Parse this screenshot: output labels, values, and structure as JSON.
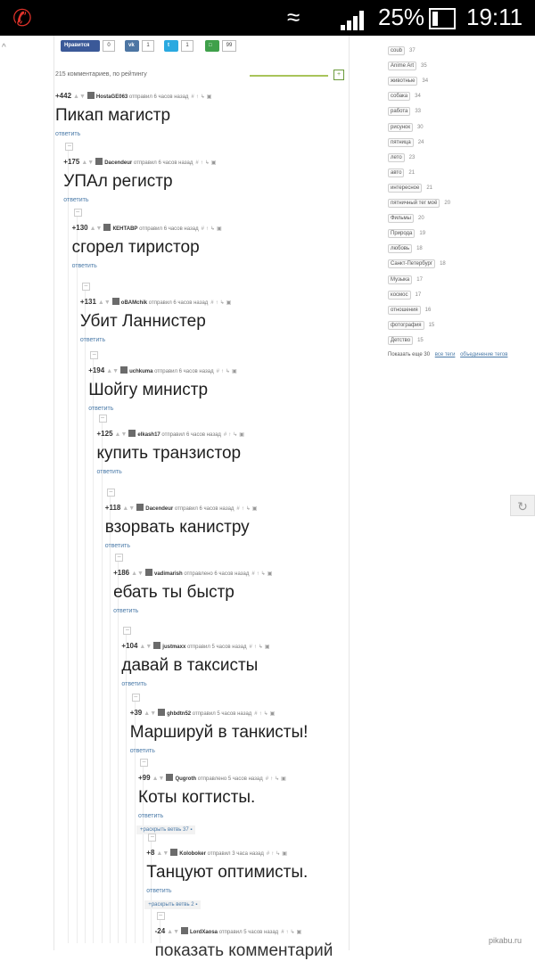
{
  "status_bar": {
    "battery": "25%",
    "time": "19:11"
  },
  "share": [
    {
      "label": "Нравится",
      "count": "0",
      "color": "#3b5998"
    },
    {
      "label": "",
      "count": "1",
      "color": "#4c75a3"
    },
    {
      "label": "",
      "count": "1",
      "color": "#2aa9e0"
    },
    {
      "label": "",
      "count": "99",
      "color": "#3fa04a"
    }
  ],
  "comments_header": "215 комментариев, по рейтингу",
  "comments": [
    {
      "rating": "+442",
      "user": "HostaGE063",
      "time": "отправил 6 часов назад",
      "text": "Пикап магистр",
      "reply": "ответить"
    },
    {
      "rating": "+175",
      "user": "Dacendeur",
      "time": "отправил 6 часов назад",
      "text": "УПАл регистр",
      "reply": "ответить"
    },
    {
      "rating": "+130",
      "user": "КЕНТАВР",
      "time": "отправил 6 часов назад",
      "text": "сгорел тиристор",
      "reply": "ответить"
    },
    {
      "rating": "+131",
      "user": "oBAMchik",
      "time": "отправил 6 часов назад",
      "text": "Убит Ланнистер",
      "reply": "ответить"
    },
    {
      "rating": "+194",
      "user": "uchkuma",
      "time": "отправил 6 часов назад",
      "text": "Шойгу министр",
      "reply": "ответить"
    },
    {
      "rating": "+125",
      "user": "elkash17",
      "time": "отправил 6 часов назад",
      "text": "купить транзистор",
      "reply": "ответить"
    },
    {
      "rating": "+118",
      "user": "Dacendeur",
      "time": "отправил 6 часов назад",
      "text": "взорвать канистру",
      "reply": "ответить"
    },
    {
      "rating": "+186",
      "user": "vadimarish",
      "time": "отправлено 6 часов назад",
      "text": "ебать ты быстр",
      "reply": "ответить"
    },
    {
      "rating": "+104",
      "user": "justmaxx",
      "time": "отправил 5 часов назад",
      "text": "давай в таксисты",
      "reply": "ответить"
    },
    {
      "rating": "+39",
      "user": "ghbdtn52",
      "time": "отправил 5 часов назад",
      "text": "Маршируй в танкисты!",
      "reply": "ответить"
    },
    {
      "rating": "+99",
      "user": "Qugroth",
      "time": "отправлено 5 часов назад",
      "text": "Коты когтисты.",
      "reply": "ответить",
      "expand": "раскрыть ветвь 37"
    },
    {
      "rating": "+8",
      "user": "Koloboker",
      "time": "отправил 3 часа назад",
      "text": "Танцуют оптимисты.",
      "reply": "ответить",
      "expand": "раскрыть ветвь 2"
    },
    {
      "rating": "-24",
      "user": "LordXaosa",
      "time": "отправил 5 часов назад",
      "text": "показать комментарий",
      "reply": ""
    }
  ],
  "tags": [
    {
      "name": "coub",
      "count": "37"
    },
    {
      "name": "Anime Art",
      "count": "35"
    },
    {
      "name": "животные",
      "count": "34"
    },
    {
      "name": "собака",
      "count": "34"
    },
    {
      "name": "работа",
      "count": "33"
    },
    {
      "name": "рисунок",
      "count": "30"
    },
    {
      "name": "пятница",
      "count": "24"
    },
    {
      "name": "лето",
      "count": "23"
    },
    {
      "name": "авто",
      "count": "21"
    },
    {
      "name": "интересное",
      "count": "21"
    },
    {
      "name": "пятничный тег моё",
      "count": "20"
    },
    {
      "name": "Фильмы",
      "count": "20"
    },
    {
      "name": "Природа",
      "count": "19"
    },
    {
      "name": "любовь",
      "count": "18"
    },
    {
      "name": "Санкт-Петербург",
      "count": "18"
    },
    {
      "name": "Музыка",
      "count": "17"
    },
    {
      "name": "космос",
      "count": "17"
    },
    {
      "name": "отношения",
      "count": "16"
    },
    {
      "name": "фотография",
      "count": "15"
    },
    {
      "name": "Детство",
      "count": "15"
    }
  ],
  "tags_footer": {
    "more": "Показать еще 30",
    "all": "все теги",
    "merge": "объединение тегов"
  },
  "watermark": "pikabu.ru"
}
